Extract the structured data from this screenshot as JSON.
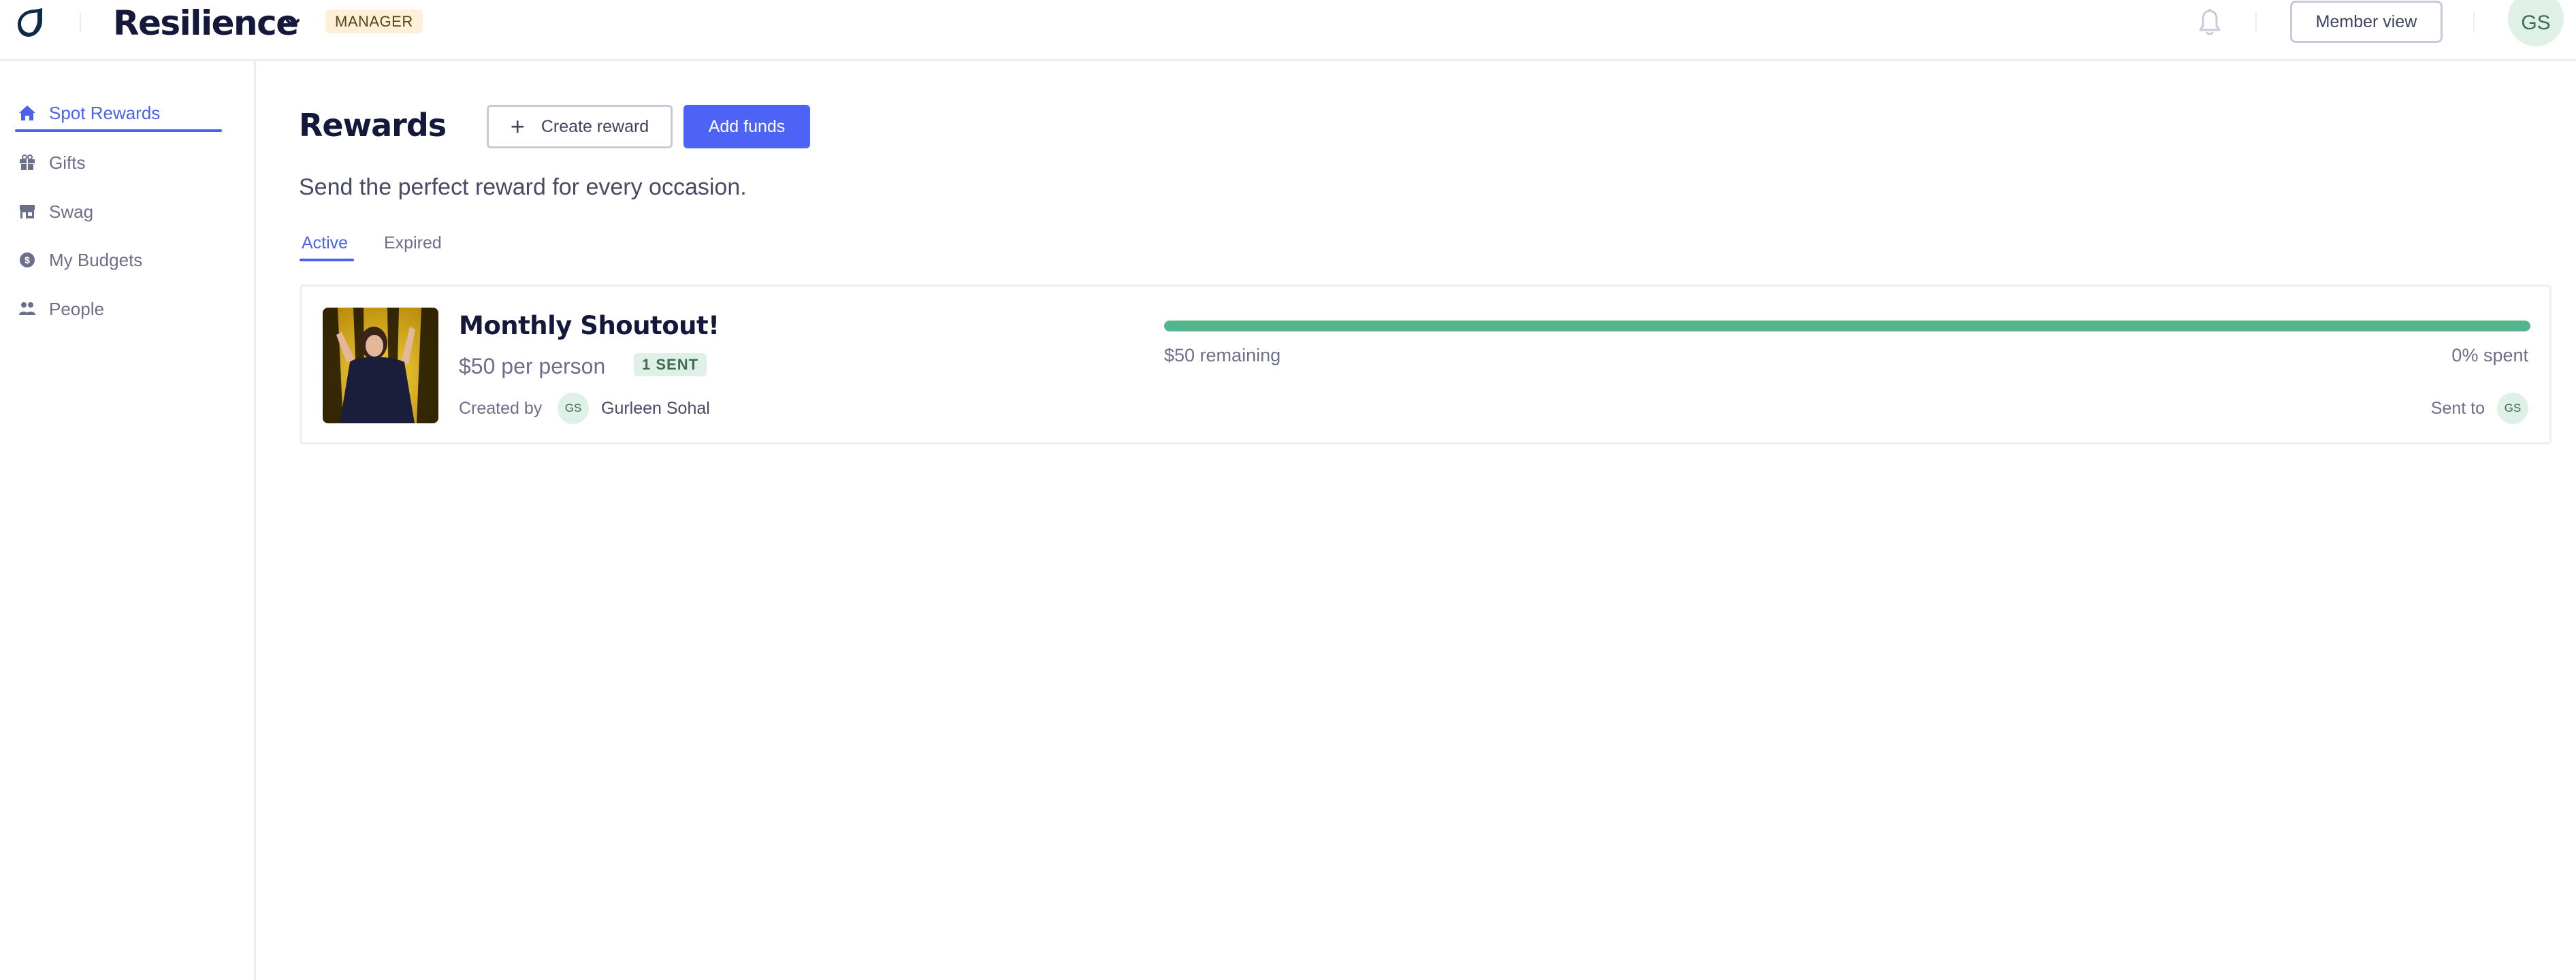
{
  "header": {
    "brand_name": "Resilience",
    "role_badge": "MANAGER",
    "member_view_label": "Member view",
    "user_initials": "GS"
  },
  "sidebar": {
    "items": [
      {
        "label": "Spot Rewards",
        "icon": "home-icon",
        "active": true
      },
      {
        "label": "Gifts",
        "icon": "gift-icon",
        "active": false
      },
      {
        "label": "Swag",
        "icon": "store-icon",
        "active": false
      },
      {
        "label": "My Budgets",
        "icon": "dollar-circle-icon",
        "active": false
      },
      {
        "label": "People",
        "icon": "people-icon",
        "active": false
      }
    ]
  },
  "main": {
    "title": "Rewards",
    "create_reward_label": "Create reward",
    "add_funds_label": "Add funds",
    "subtitle": "Send the perfect reward for every occasion.",
    "tabs": [
      {
        "label": "Active",
        "active": true
      },
      {
        "label": "Expired",
        "active": false
      }
    ],
    "rewards": [
      {
        "title": "Monthly Shoutout!",
        "amount_text": "$50 per person",
        "sent_badge": "1 SENT",
        "created_by_label": "Created by",
        "creator_initials": "GS",
        "creator_name": "Gurleen Sohal",
        "remaining_text": "$50 remaining",
        "spent_text": "0% spent",
        "remaining_fraction": 1.0,
        "sent_to_label": "Sent to",
        "recipient_initials": "GS"
      }
    ]
  },
  "colors": {
    "accent": "#4a61f0",
    "primary_button": "#4d63f5",
    "progress": "#52b58b",
    "avatar_bg": "#dff0e6",
    "badge_bg": "#fcf1d8"
  }
}
